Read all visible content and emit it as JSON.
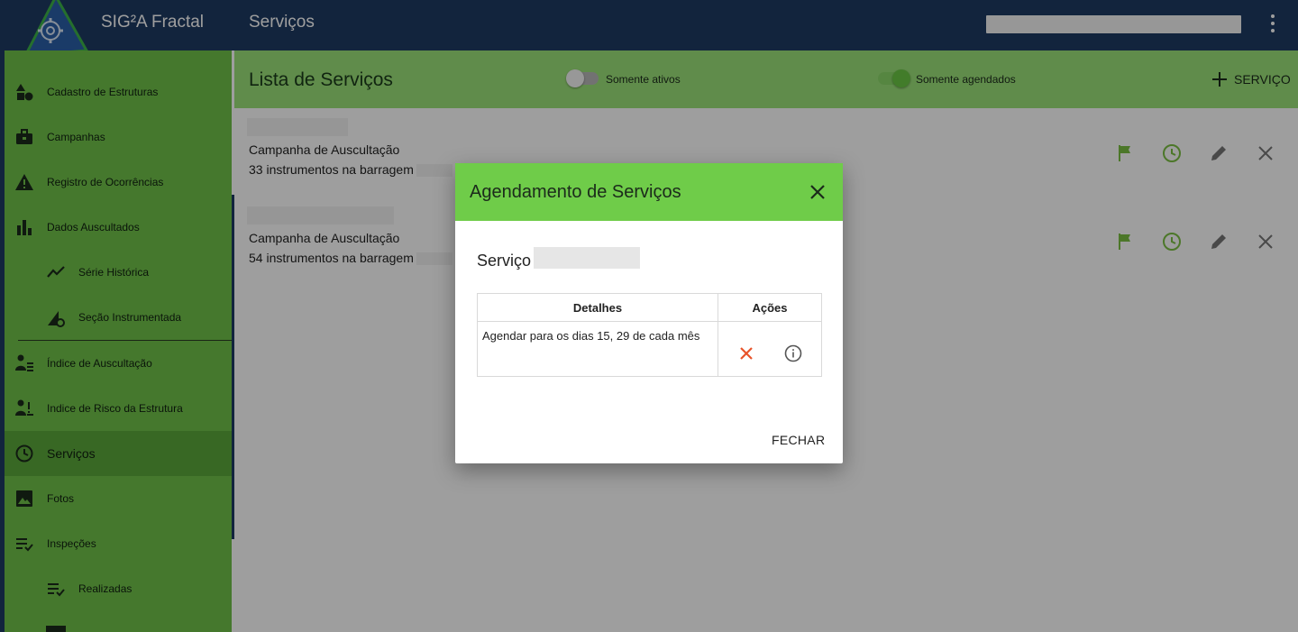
{
  "appbar": {
    "app_name": "SIG²A Fractal",
    "page_title": "Serviços"
  },
  "sidebar": {
    "items": [
      {
        "label": "Cadastro de Estruturas",
        "icon": "shapes-icon"
      },
      {
        "label": "Campanhas",
        "icon": "briefcase-icon"
      },
      {
        "label": "Registro de Ocorrências",
        "icon": "warning-icon"
      },
      {
        "label": "Dados Auscultados",
        "icon": "bar-chart-icon"
      },
      {
        "label": "Série Histórica",
        "icon": "trend-line-icon"
      },
      {
        "label": "Seção Instrumentada",
        "icon": "section-gear-icon"
      },
      {
        "label": "Índice de Auscultação",
        "icon": "person-list-icon"
      },
      {
        "label": "Indice de Risco da Estrutura",
        "icon": "person-risk-icon"
      },
      {
        "label": "Serviços",
        "icon": "clock-icon"
      },
      {
        "label": "Fotos",
        "icon": "image-icon"
      },
      {
        "label": "Inspeções",
        "icon": "checklist-icon"
      },
      {
        "label": "Realizadas",
        "icon": "checklist-icon"
      }
    ]
  },
  "list": {
    "title": "Lista de Serviços",
    "filter_active": {
      "label": "Somente ativos",
      "on": false
    },
    "filter_scheduled": {
      "label": "Somente agendados",
      "on": true
    },
    "add_label": "SERVIÇO",
    "services": [
      {
        "type": "Campanha de Auscultação",
        "count": "33 instrumentos na barragem"
      },
      {
        "type": "Campanha de Auscultação",
        "count": "54 instrumentos na barragem"
      }
    ]
  },
  "dialog": {
    "title": "Agendamento de Serviços",
    "service_label": "Serviço",
    "table": {
      "headers": [
        "Detalhes",
        "Ações"
      ],
      "rows": [
        {
          "details": "Agendar para os dias 15, 29 de cada mês"
        }
      ]
    },
    "close_label": "FECHAR"
  },
  "colors": {
    "appbar": "#1e3a63",
    "sidebar": "#70c24a",
    "header_green": "#9ce27a",
    "dialog_header": "#6fcc49",
    "action_green": "#7bc043",
    "delete_red": "#e8532a"
  }
}
